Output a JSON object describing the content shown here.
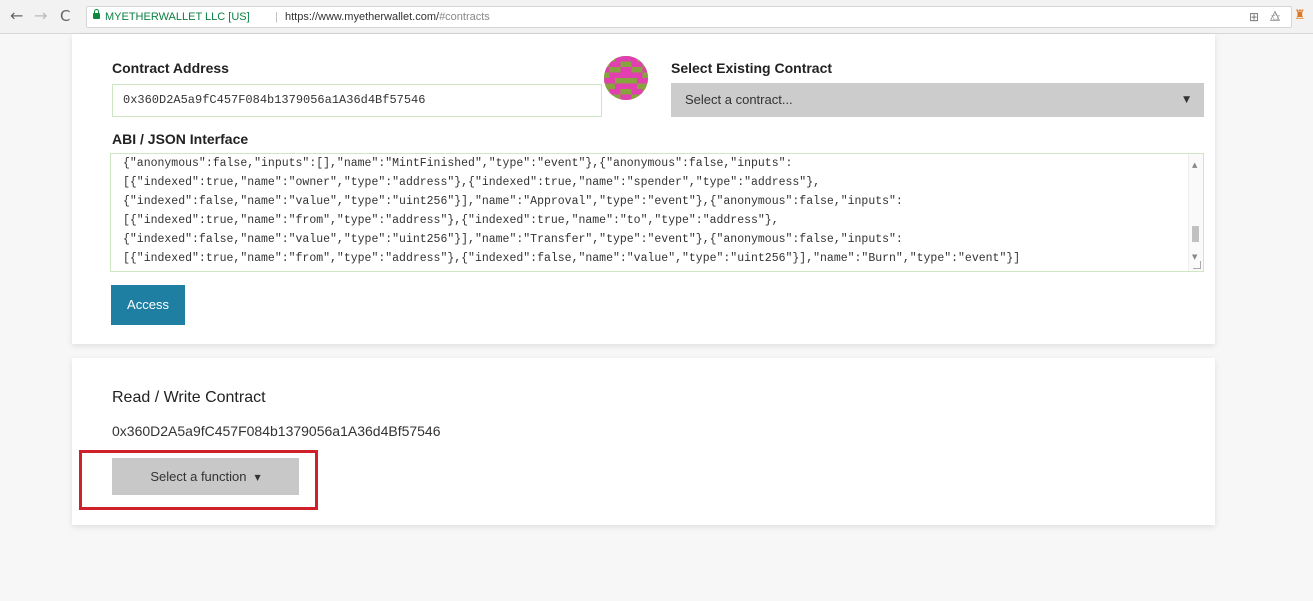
{
  "browser": {
    "org_label": "MYETHERWALLET LLC [US]",
    "url_host": "https://www.myetherwallet.com/",
    "url_path": "#contracts",
    "back_icon": "arrow-left-icon",
    "forward_icon": "arrow-right-icon",
    "reload_icon": "reload-icon"
  },
  "contract": {
    "address_label": "Contract Address",
    "address_value": "0x360D2A5a9fC457F084b1379056a1A36d4Bf57546",
    "existing_label": "Select Existing Contract",
    "existing_placeholder": "Select a contract...",
    "abi_label": "ABI / JSON Interface",
    "abi_lines": [
      "{\"anonymous\":false,\"inputs\":[],\"name\":\"MintFinished\",\"type\":\"event\"},{\"anonymous\":false,\"inputs\":",
      "[{\"indexed\":true,\"name\":\"owner\",\"type\":\"address\"},{\"indexed\":true,\"name\":\"spender\",\"type\":\"address\"},",
      "{\"indexed\":false,\"name\":\"value\",\"type\":\"uint256\"}],\"name\":\"Approval\",\"type\":\"event\"},{\"anonymous\":false,\"inputs\":",
      "[{\"indexed\":true,\"name\":\"from\",\"type\":\"address\"},{\"indexed\":true,\"name\":\"to\",\"type\":\"address\"},",
      "{\"indexed\":false,\"name\":\"value\",\"type\":\"uint256\"}],\"name\":\"Transfer\",\"type\":\"event\"},{\"anonymous\":false,\"inputs\":",
      "[{\"indexed\":true,\"name\":\"from\",\"type\":\"address\"},{\"indexed\":false,\"name\":\"value\",\"type\":\"uint256\"}],\"name\":\"Burn\",\"type\":\"event\"}]"
    ],
    "access_label": "Access"
  },
  "readwrite": {
    "title": "Read / Write Contract",
    "address": "0x360D2A5a9fC457F084b1379056a1A36d4Bf57546",
    "function_select_label": "Select a function"
  },
  "colors": {
    "access_button": "#1e7fa3",
    "highlight_box": "#d0202a",
    "select_bg": "#cccccc"
  }
}
